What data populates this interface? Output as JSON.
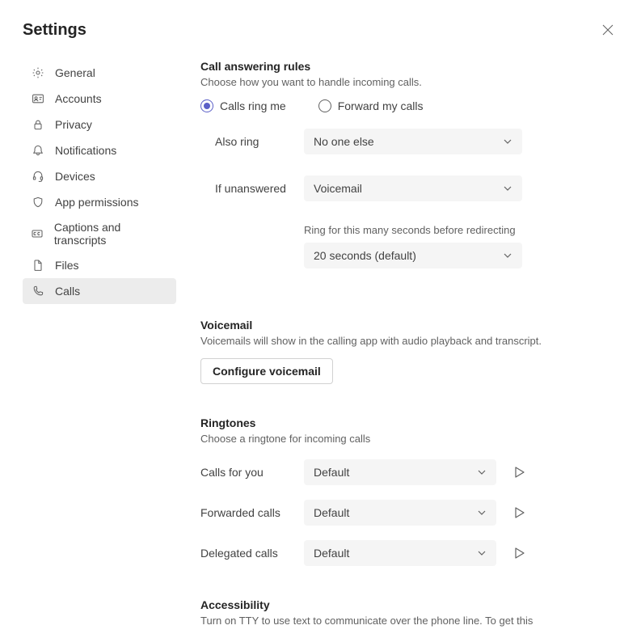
{
  "title": "Settings",
  "nav": {
    "items": [
      {
        "label": "General"
      },
      {
        "label": "Accounts"
      },
      {
        "label": "Privacy"
      },
      {
        "label": "Notifications"
      },
      {
        "label": "Devices"
      },
      {
        "label": "App permissions"
      },
      {
        "label": "Captions and transcripts"
      },
      {
        "label": "Files"
      },
      {
        "label": "Calls"
      }
    ]
  },
  "callRules": {
    "title": "Call answering rules",
    "desc": "Choose how you want to handle incoming calls.",
    "radio1": "Calls ring me",
    "radio2": "Forward my calls",
    "alsoRingLabel": "Also ring",
    "alsoRingValue": "No one else",
    "ifUnansweredLabel": "If unanswered",
    "ifUnansweredValue": "Voicemail",
    "ringDurationLabel": "Ring for this many seconds before redirecting",
    "ringDurationValue": "20 seconds (default)"
  },
  "voicemail": {
    "title": "Voicemail",
    "desc": "Voicemails will show in the calling app with audio playback and transcript.",
    "button": "Configure voicemail"
  },
  "ringtones": {
    "title": "Ringtones",
    "desc": "Choose a ringtone for incoming calls",
    "rows": [
      {
        "label": "Calls for you",
        "value": "Default"
      },
      {
        "label": "Forwarded calls",
        "value": "Default"
      },
      {
        "label": "Delegated calls",
        "value": "Default"
      }
    ]
  },
  "accessibility": {
    "title": "Accessibility",
    "desc": "Turn on TTY to use text to communicate over the phone line. To get this"
  }
}
